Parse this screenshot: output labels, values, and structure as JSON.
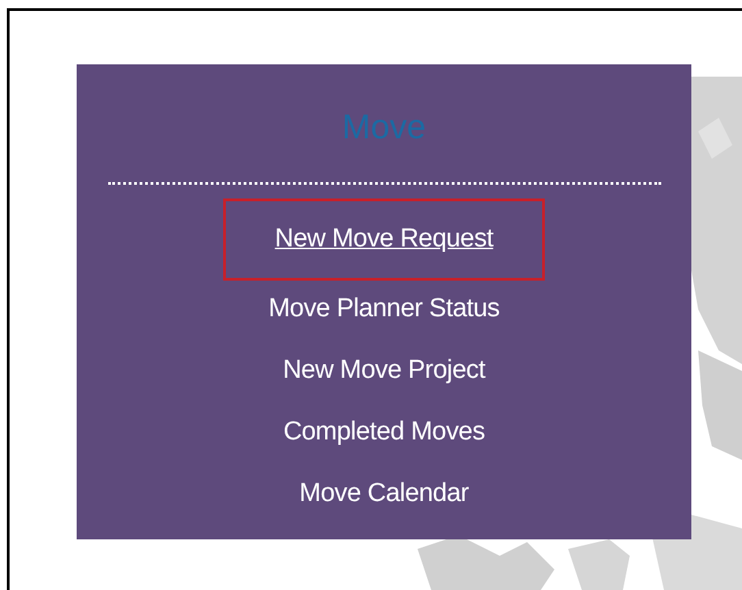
{
  "menu": {
    "title": "Move",
    "items": [
      {
        "label": "New Move Request",
        "selected": true
      },
      {
        "label": "Move Planner Status",
        "selected": false
      },
      {
        "label": "New Move Project",
        "selected": false
      },
      {
        "label": "Completed Moves",
        "selected": false
      },
      {
        "label": "Move Calendar",
        "selected": false
      }
    ]
  }
}
